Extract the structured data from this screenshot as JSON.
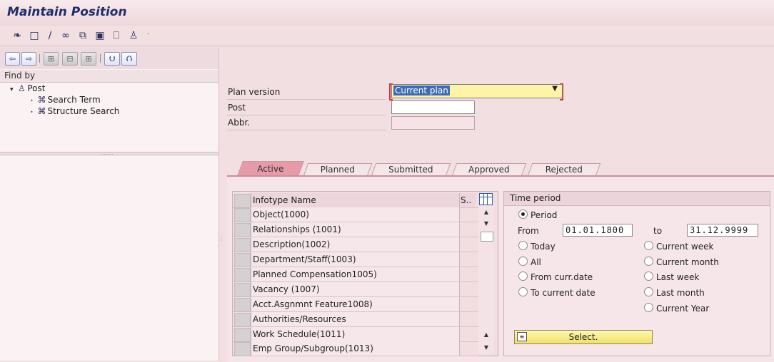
{
  "title": "Maintain Position",
  "toolbar": {
    "icons": [
      "glasses-icon",
      "create-icon",
      "change-icon",
      "display-icon",
      "copy-icon",
      "delimit-icon",
      "delete-icon",
      "person-icon",
      "info-icon"
    ]
  },
  "left": {
    "find_by": "Find by",
    "tree": {
      "root": "Post",
      "children": [
        "Search Term",
        "Structure Search"
      ]
    }
  },
  "header": {
    "plan_version_label": "Plan version",
    "plan_version_value": "Current plan",
    "post_label": "Post",
    "post_value": "",
    "abbr_label": "Abbr.",
    "abbr_value": ""
  },
  "tabs": [
    {
      "label": "Active",
      "active": true
    },
    {
      "label": "Planned",
      "active": false
    },
    {
      "label": "Submitted",
      "active": false
    },
    {
      "label": "Approved",
      "active": false
    },
    {
      "label": "Rejected",
      "active": false
    }
  ],
  "grid": {
    "col_name": "Infotype Name",
    "col_status": "S..",
    "rows": [
      "Object(1000)",
      "Relationships (1001)",
      "Description(1002)",
      "Department/Staff(1003)",
      "Planned Compensation1005)",
      "Vacancy (1007)",
      "Acct.Asgnmnt Feature1008)",
      "Authorities/Resources",
      "Work Schedule(1011)",
      "Emp Group/Subgroup(1013)"
    ]
  },
  "time_period": {
    "title": "Time period",
    "period": "Period",
    "from_label": "From",
    "from_value": "01.01.1800",
    "to_label": "to",
    "to_value": "31.12.9999",
    "left_options": [
      "Today",
      "All",
      "From curr.date",
      "To current date"
    ],
    "right_options": [
      "Current week",
      "Current month",
      "Last week",
      "Last month",
      "Current Year"
    ],
    "select_label": "Select."
  },
  "colors": {
    "background": "#f1dfe2",
    "title_text": "#1f2d6a",
    "active_tab": "#e79aa7",
    "plan_field": "#fff3a8",
    "selection": "#3e6bb8"
  }
}
